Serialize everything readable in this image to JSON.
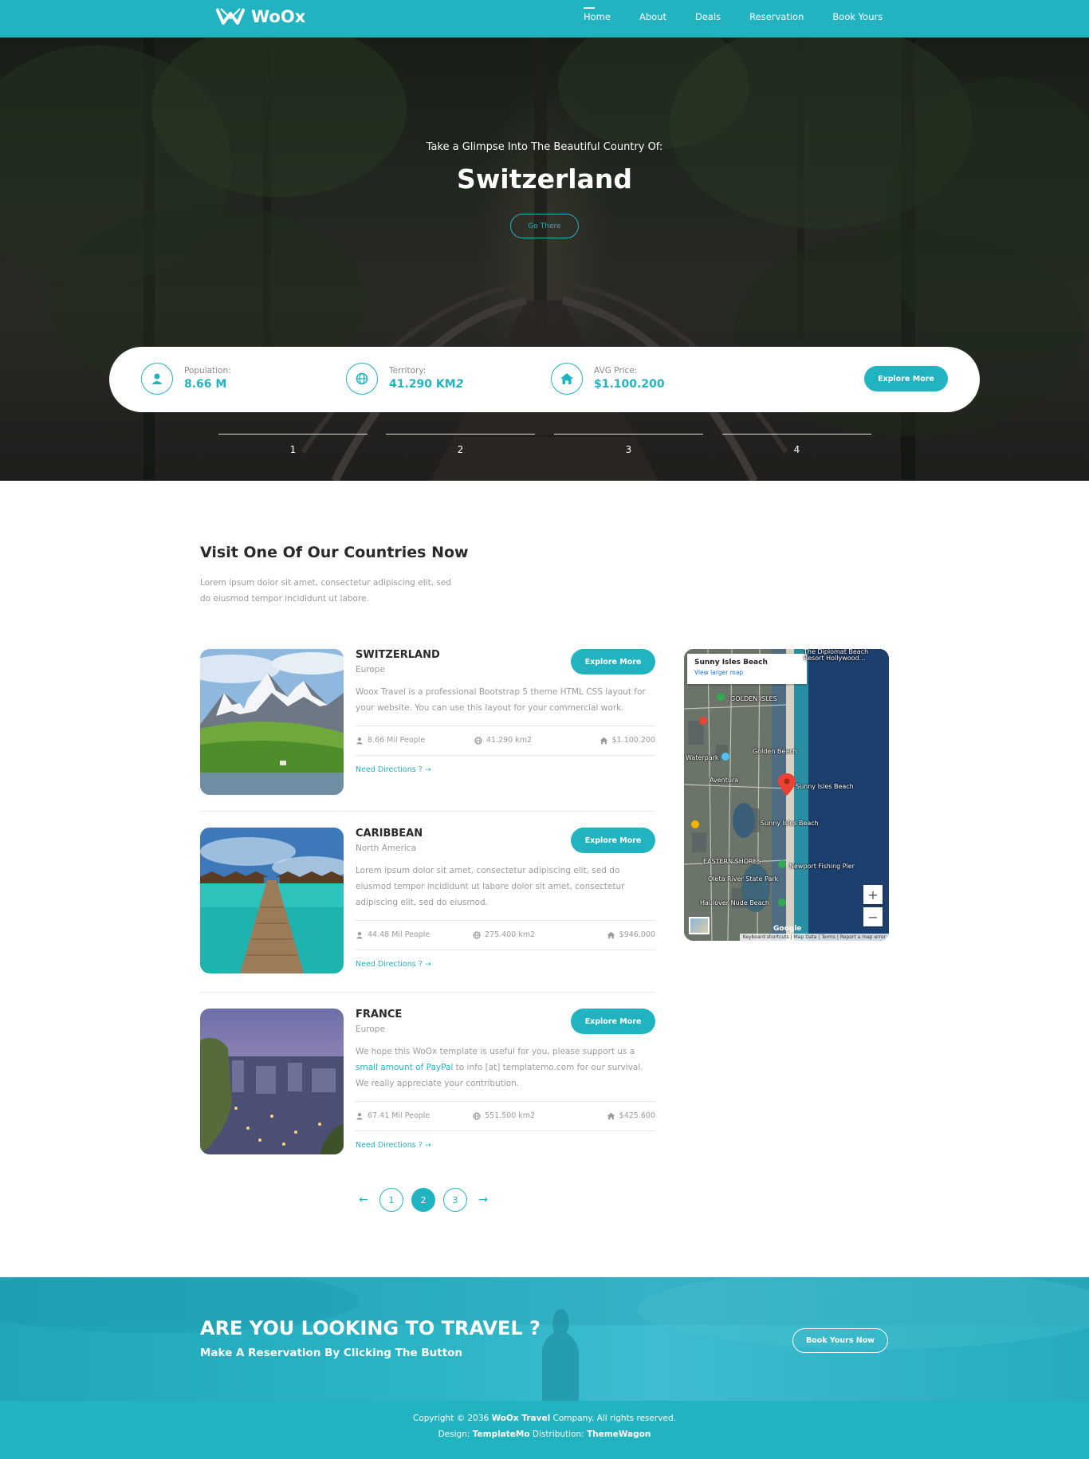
{
  "brand": {
    "name": "WoOx",
    "accent": "#22b3c1"
  },
  "nav": [
    {
      "label": "Home",
      "active": true
    },
    {
      "label": "About"
    },
    {
      "label": "Deals"
    },
    {
      "label": "Reservation"
    },
    {
      "label": "Book Yours"
    }
  ],
  "hero": {
    "subtitle": "Take a Glimpse Into The Beautiful Country Of:",
    "title": "Switzerland",
    "go_button": "Go There",
    "stats": [
      {
        "icon": "user-icon",
        "label": "Population:",
        "value": "8.66 M"
      },
      {
        "icon": "globe-icon",
        "label": "Territory:",
        "value": "41.290 KM",
        "suffix": "2"
      },
      {
        "icon": "home-icon",
        "label": "AVG Price:",
        "value": "$1.100.200"
      }
    ],
    "explore_button": "Explore More",
    "slides": [
      "1",
      "2",
      "3",
      "4"
    ]
  },
  "countries": {
    "title": "Visit One Of Our Countries Now",
    "description": "Lorem ipsum dolor sit amet, consectetur adipiscing elit, sed do eiusmod tempor incididunt ut labore.",
    "items": [
      {
        "name": "SWITZERLAND",
        "region": "Europe",
        "button": "Explore More",
        "text": "Woox Travel is a professional Bootstrap 5 theme HTML CSS layout for your website. You can use this layout for your commercial work.",
        "people": "8.66 Mil People",
        "area": "41.290 km2",
        "price": "$1.100.200",
        "directions": "Need Directions ?"
      },
      {
        "name": "CARIBBEAN",
        "region": "North America",
        "button": "Explore More",
        "text": "Lorem ipsum dolor sit amet, consectetur adipiscing elit, sed do eiusmod tempor incididunt ut labore dolor sit amet, consectetur adipiscing elit, sed do eiusmod.",
        "people": "44.48 Mil People",
        "area": "275.400 km2",
        "price": "$946.000",
        "directions": "Need Directions ?"
      },
      {
        "name": "FRANCE",
        "region": "Europe",
        "button": "Explore More",
        "text_before": "We hope this WoOx template is useful for you, please support us a ",
        "text_link": "small amount of PayPal",
        "text_after": " to info [at] templatemo.com for our survival. We really appreciate your contribution.",
        "people": "67.41 Mil People",
        "area": "551.500 km2",
        "price": "$425.600",
        "directions": "Need Directions ?"
      }
    ]
  },
  "map": {
    "place": "Sunny Isles Beach",
    "link": "View larger map",
    "labels": [
      "The Diplomat Beach",
      "Resort Hollywood...",
      "GOLDEN ISLES",
      "Golden Beach",
      "Waterpark",
      "Aventura",
      "Sunny Isles Beach",
      "Sunny Isles Beach",
      "EASTERN SHORES",
      "Newport Fishing Pier",
      "Oleta River State Park",
      "Haulover Nude Beach"
    ],
    "google": "Google",
    "footer": "Keyboard shortcuts | Map Data | Terms | Report a map error",
    "zoom_in": "+",
    "zoom_out": "−"
  },
  "pagination": {
    "prev": "←",
    "next": "→",
    "pages": [
      "1",
      "2",
      "3"
    ],
    "active": "2"
  },
  "cta": {
    "title": "ARE YOU LOOKING TO TRAVEL ?",
    "subtitle": "Make A Reservation By Clicking The Button",
    "button": "Book Yours Now"
  },
  "footer": {
    "line1_before": "Copyright © 2036 ",
    "line1_brand": "WoOx Travel",
    "line1_after": " Company. All rights reserved.",
    "line2_design_label": "Design: ",
    "line2_design": "TemplateMo",
    "line2_dist_label": " Distribution: ",
    "line2_dist": "ThemeWagon"
  }
}
